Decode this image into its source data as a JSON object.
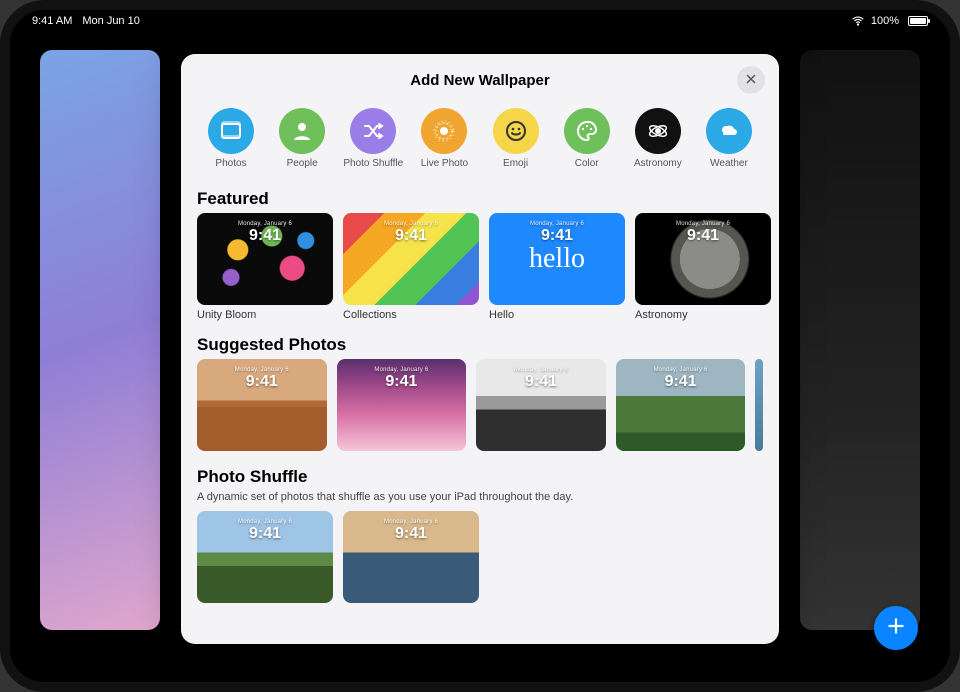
{
  "status": {
    "time": "9:41 AM",
    "date": "Mon Jun 10",
    "battery_pct": "100%"
  },
  "sheet": {
    "title": "Add New Wallpaper"
  },
  "categories": [
    {
      "id": "photos",
      "label": "Photos",
      "icon": "photos-icon",
      "bg": "#2aa9e6",
      "fg": "#fff"
    },
    {
      "id": "people",
      "label": "People",
      "icon": "person-icon",
      "bg": "#6fbf5a",
      "fg": "#fff"
    },
    {
      "id": "shuffle",
      "label": "Photo Shuffle",
      "icon": "shuffle-icon",
      "bg": "#9a7de6",
      "fg": "#fff"
    },
    {
      "id": "live",
      "label": "Live Photo",
      "icon": "live-photo-icon",
      "bg": "#f0a530",
      "fg": "#fff"
    },
    {
      "id": "emoji",
      "label": "Emoji",
      "icon": "emoji-icon",
      "bg": "#f5d648",
      "fg": "#333"
    },
    {
      "id": "color",
      "label": "Color",
      "icon": "palette-icon",
      "bg": "#6fbf5a",
      "fg": "#fff"
    },
    {
      "id": "astro",
      "label": "Astronomy",
      "icon": "astronomy-icon",
      "bg": "#111111",
      "fg": "#fff"
    },
    {
      "id": "weather",
      "label": "Weather",
      "icon": "weather-icon",
      "bg": "#2aa9e6",
      "fg": "#fff"
    }
  ],
  "featured": {
    "title": "Featured",
    "items": [
      {
        "label": "Unity Bloom",
        "date": "Monday, January 6",
        "time": "9:41"
      },
      {
        "label": "Collections",
        "date": "Monday, January 6",
        "time": "9:41"
      },
      {
        "label": "Hello",
        "date": "Monday, January 6",
        "time": "9:41",
        "hello_text": "hello"
      },
      {
        "label": "Astronomy",
        "date": "Monday, January 6",
        "time": "9:41"
      }
    ]
  },
  "suggested": {
    "title": "Suggested Photos",
    "items": [
      {
        "date": "Monday, January 6",
        "time": "9:41"
      },
      {
        "date": "Monday, January 6",
        "time": "9:41"
      },
      {
        "date": "Monday, January 6",
        "time": "9:41"
      },
      {
        "date": "Monday, January 6",
        "time": "9:41"
      }
    ]
  },
  "shuffle": {
    "title": "Photo Shuffle",
    "subtitle": "A dynamic set of photos that shuffle as you use your iPad throughout the day.",
    "items": [
      {
        "date": "Monday, January 6",
        "time": "9:41"
      },
      {
        "date": "Monday, January 6",
        "time": "9:41"
      }
    ]
  }
}
